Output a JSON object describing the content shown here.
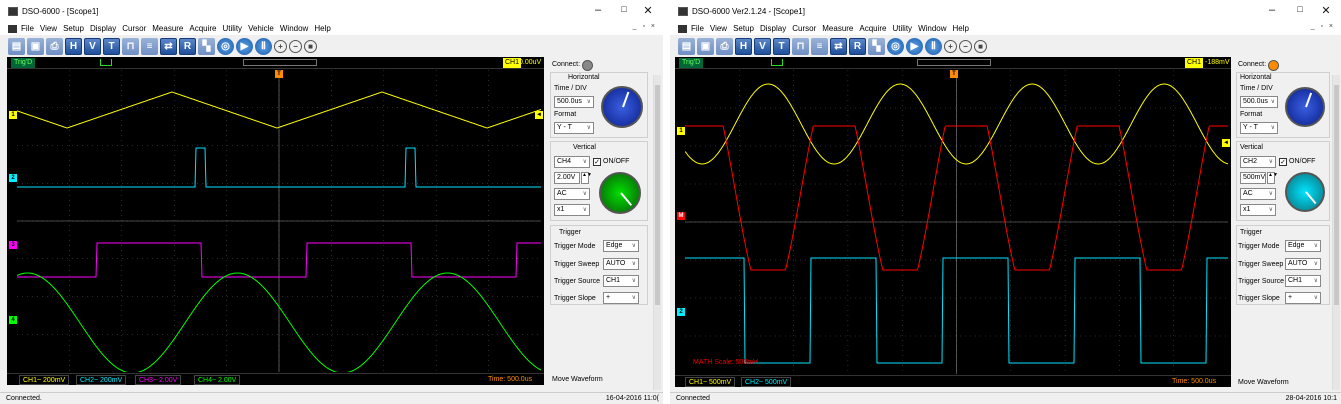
{
  "windows": [
    {
      "title": "DSO-6000 - [Scope1]",
      "menu": [
        "File",
        "View",
        "Setup",
        "Display",
        "Cursor",
        "Measure",
        "Acquire",
        "Utility",
        "Vehicle",
        "Window",
        "Help"
      ],
      "trig_state": "Trig'D",
      "trig_channel": "CH1",
      "trig_level": "0.00uV",
      "connect_label": "Connect:",
      "channels": [
        {
          "label": "CH1~ 200mV",
          "color": "#ffff00",
          "marker": "1"
        },
        {
          "label": "CH2~ 200mV",
          "color": "#00e5ff",
          "marker": "2"
        },
        {
          "label": "CH3~ 2.00V",
          "color": "#ff00ff",
          "marker": "3"
        },
        {
          "label": "CH4~ 2.00V",
          "color": "#00ff00",
          "marker": "4"
        }
      ],
      "time_label": "Time: 500.0us",
      "horizontal_title": "Horizontal",
      "time_div_label": "Time / DIV",
      "time_div_value": "500.0us",
      "format_label": "Format",
      "format_value": "Y - T",
      "vertical_title": "Vertical",
      "vert_channel": "CH4",
      "onoff_label": "ON/OFF",
      "volts_value": "2.00V",
      "coupling_value": "AC",
      "probe_value": "x1",
      "trigger_title": "Trigger",
      "trigger_mode_label": "Trigger Mode",
      "trigger_mode_value": "Edge",
      "trigger_sweep_label": "Trigger Sweep",
      "trigger_sweep_value": "AUTO",
      "trigger_source_label": "Trigger Source",
      "trigger_source_value": "CH1",
      "trigger_slope_label": "Trigger Slope",
      "trigger_slope_value": "+",
      "move_waveform": "Move Waveform",
      "status_text": "Connected.",
      "status_date": "16-04-2016  11:0(",
      "vert_knob_color": "#00e000",
      "connect_led_color": "#888888"
    },
    {
      "title": "DSO-6000 Ver2.1.24 - [Scope1]",
      "menu": [
        "File",
        "View",
        "Setup",
        "Display",
        "Cursor",
        "Measure",
        "Acquire",
        "Utility",
        "Window",
        "Help"
      ],
      "trig_state": "Trig'D",
      "trig_channel": "CH1",
      "trig_level": "-188mV",
      "connect_label": "Connect:",
      "channels": [
        {
          "label": "CH1~ 500mV",
          "color": "#ffff00",
          "marker": "1"
        },
        {
          "label": "CH2~ 500mV",
          "color": "#00e5ff",
          "marker": "2"
        }
      ],
      "math_label": "MATH Scale:  500mV",
      "time_label": "Time: 500.0us",
      "horizontal_title": "Horizontal",
      "time_div_label": "Time / DIV",
      "time_div_value": "500.0us",
      "format_label": "Format",
      "format_value": "Y - T",
      "vertical_title": "Vertical",
      "vert_channel": "CH2",
      "onoff_label": "ON/OFF",
      "volts_value": "500mV",
      "coupling_value": "AC",
      "probe_value": "x1",
      "trigger_title": "Trigger",
      "trigger_mode_label": "Trigger Mode",
      "trigger_mode_value": "Edge",
      "trigger_sweep_label": "Trigger Sweep",
      "trigger_sweep_value": "AUTO",
      "trigger_source_label": "Trigger Source",
      "trigger_source_value": "CH1",
      "trigger_slope_label": "Trigger Slope",
      "trigger_slope_value": "+",
      "move_waveform": "Move Waveform",
      "status_text": "Connected",
      "status_date": "28-04-2016  10:1",
      "vert_knob_color": "#00e5ff",
      "connect_led_color": "#ff8c00"
    }
  ],
  "icons": {
    "toolbar": [
      "open-icon",
      "save-icon",
      "print-icon",
      "horizontal-icon",
      "vertical-icon",
      "trigger-icon",
      "measure-icon",
      "math-icon",
      "fft-icon",
      "ref-icon",
      "record-icon",
      "auto-icon",
      "run-icon",
      "pause-icon",
      "zoom-in-icon",
      "zoom-out-icon",
      "stop-icon"
    ]
  },
  "colors": {
    "ch1": "#ffff00",
    "ch2": "#00e5ff",
    "ch3": "#ff00ff",
    "ch4": "#00ff00",
    "math": "#ff0000",
    "grid": "#555555",
    "trigger_marker": "#ff8c00"
  }
}
